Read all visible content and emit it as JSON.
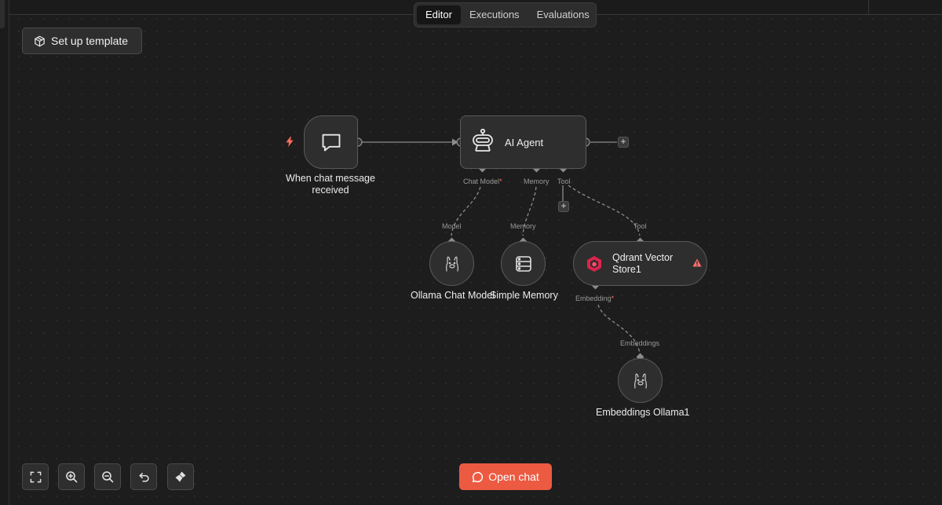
{
  "tabs": [
    {
      "label": "Editor",
      "active": true
    },
    {
      "label": "Executions",
      "active": false
    },
    {
      "label": "Evaluations",
      "active": false
    }
  ],
  "template_button": {
    "label": "Set up template",
    "icon": "package-icon"
  },
  "nodes": {
    "chat_trigger": {
      "label_line1": "When chat message",
      "label_line2": "received",
      "icon": "chat-bubble-icon",
      "trigger_icon": "bolt-icon"
    },
    "ai_agent": {
      "label": "AI Agent",
      "icon": "robot-icon",
      "ports": {
        "chat_model": "Chat Model",
        "required_mark": "*",
        "memory": "Memory",
        "tool": "Tool"
      }
    },
    "ollama_chat_model": {
      "label": "Ollama Chat Model",
      "port_label": "Model",
      "icon": "ollama-icon"
    },
    "simple_memory": {
      "label": "Simple Memory",
      "port_label": "Memory",
      "icon": "database-icon"
    },
    "qdrant_vector_store": {
      "label_line1": "Qdrant Vector",
      "label_line2": "Store1",
      "port_label": "Tool",
      "bottom_port": "Embedding",
      "required_mark": "*",
      "icon": "qdrant-icon",
      "warning_icon": "warning-icon"
    },
    "embeddings_ollama": {
      "label": "Embeddings Ollama1",
      "port_label": "Embeddings",
      "icon": "ollama-icon"
    }
  },
  "controls": {
    "fit_view": "fit-view-icon",
    "zoom_in": "zoom-in-icon",
    "zoom_out": "zoom-out-icon",
    "undo": "undo-icon",
    "tidy_up": "broom-icon"
  },
  "open_chat": {
    "label": "Open chat",
    "icon": "chat-icon"
  },
  "colors": {
    "accent": "#ec5a42",
    "warning": "#ff6d6d",
    "qdrant": "#dc244c"
  }
}
